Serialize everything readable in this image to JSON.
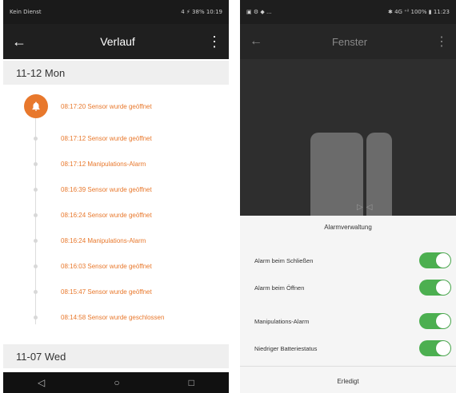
{
  "left_phone": {
    "status_bar": {
      "carrier": "Kein Dienst",
      "right_info": "4 ⚡ 38% 10:19"
    },
    "appbar": {
      "back_glyph": "←",
      "title": "Verlauf",
      "more_glyph": "⋮"
    },
    "sections": [
      {
        "date": "11-12  Mon"
      },
      {
        "date": "11-07  Wed"
      }
    ],
    "events": [
      "08:17:20 Sensor wurde geöffnet",
      "08:17:12 Sensor wurde geöffnet",
      "08:17:12 Manipulations-Alarm",
      "08:16:39 Sensor wurde geöffnet",
      "08:16:24 Sensor wurde geöffnet",
      "08:16:24 Manipulations-Alarm",
      "08:16:03 Sensor wurde geöffnet",
      "08:15:47 Sensor wurde geöffnet",
      "08:14:58 Sensor wurde geschlossen"
    ],
    "accent_color": "#e8782c",
    "navbar": {
      "back": "◁",
      "home": "○",
      "recent": "□"
    }
  },
  "right_phone": {
    "status_bar": {
      "left_info": "▣ ⚙ ◆ ...",
      "right_info": "✱ 4G ⁺ⁱˡ 100% ▮ 11:23"
    },
    "appbar": {
      "back_glyph": "←",
      "title": "Fenster",
      "more_glyph": "⋮"
    },
    "sensor_arrows": "▷◁",
    "sheet": {
      "title": "Alarmverwaltung",
      "rows": [
        {
          "label": "Alarm beim Schließen",
          "enabled": true
        },
        {
          "label": "Alarm beim Öffnen",
          "enabled": true
        },
        {
          "label": "Manipulations-Alarm",
          "enabled": true
        },
        {
          "label": "Niedriger Batteriestatus",
          "enabled": true
        }
      ],
      "done_label": "Erledigt"
    },
    "toggle_color": "#4caf50"
  },
  "icons": {
    "bell": "bell-icon",
    "back": "arrow-left-icon",
    "more": "more-vert-icon"
  }
}
